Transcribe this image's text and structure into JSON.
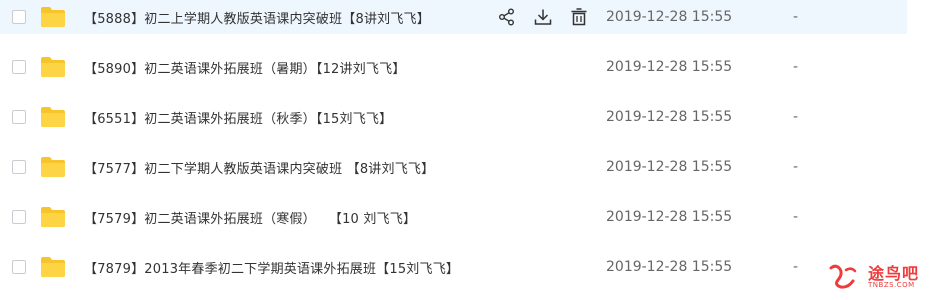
{
  "rows": [
    {
      "name": "【5888】初二上学期人教版英语课内突破班【8讲刘飞飞】",
      "date": "2019-12-28 15:55",
      "size": "-"
    },
    {
      "name": "【5890】初二英语课外拓展班（暑期）【12讲刘飞飞】",
      "date": "2019-12-28 15:55",
      "size": "-"
    },
    {
      "name": "【6551】初二英语课外拓展班（秋季）【15刘飞飞】",
      "date": "2019-12-28 15:55",
      "size": "-"
    },
    {
      "name": "【7577】初二下学期人教版英语课内突破班 【8讲刘飞飞】",
      "date": "2019-12-28 15:55",
      "size": "-"
    },
    {
      "name": "【7579】初二英语课外拓展班（寒假）   【10 刘飞飞】",
      "date": "2019-12-28 15:55",
      "size": "-"
    },
    {
      "name": "【7879】2013年春季初二下学期英语课外拓展班【15刘飞飞】",
      "date": "2019-12-28 15:55",
      "size": "-"
    }
  ],
  "row_actions": {
    "share_icon": "share-icon",
    "download_icon": "download-icon",
    "delete_icon": "trash-icon"
  },
  "watermark": {
    "text": "途鸟吧",
    "sub": "TNBZS.COM"
  },
  "colors": {
    "hover_bg": "#eef6fe",
    "folder": "#f7c52b",
    "text": "#333333",
    "meta_text": "#666666",
    "watermark": "#ef3b3b"
  }
}
